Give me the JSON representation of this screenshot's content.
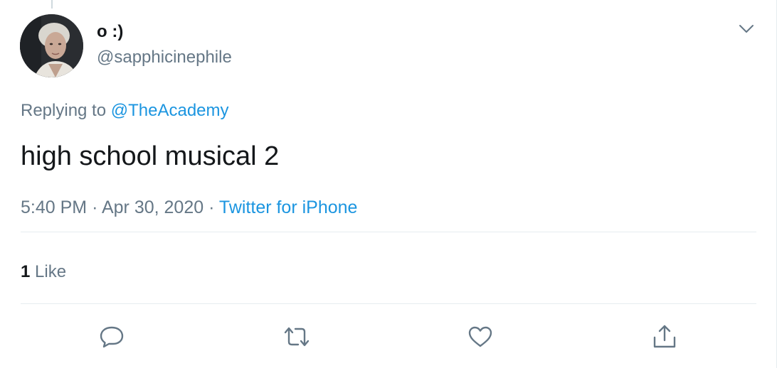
{
  "tweet": {
    "author": {
      "display_name": "o :)",
      "handle": "@sapphicinephile"
    },
    "replying_prefix": "Replying to",
    "replying_to": "@TheAcademy",
    "text": "high school musical 2",
    "time": "5:40 PM",
    "separator": "·",
    "date": "Apr 30, 2020",
    "source": "Twitter for iPhone",
    "likes": {
      "count": "1",
      "label": "Like"
    }
  },
  "icons": {
    "more": "chevron-down-icon",
    "reply": "reply-icon",
    "retweet": "retweet-icon",
    "like": "heart-icon",
    "share": "share-icon"
  },
  "colors": {
    "text_primary": "#14171a",
    "text_secondary": "#657786",
    "link": "#1b95e0",
    "divider": "#e6ecf0"
  }
}
